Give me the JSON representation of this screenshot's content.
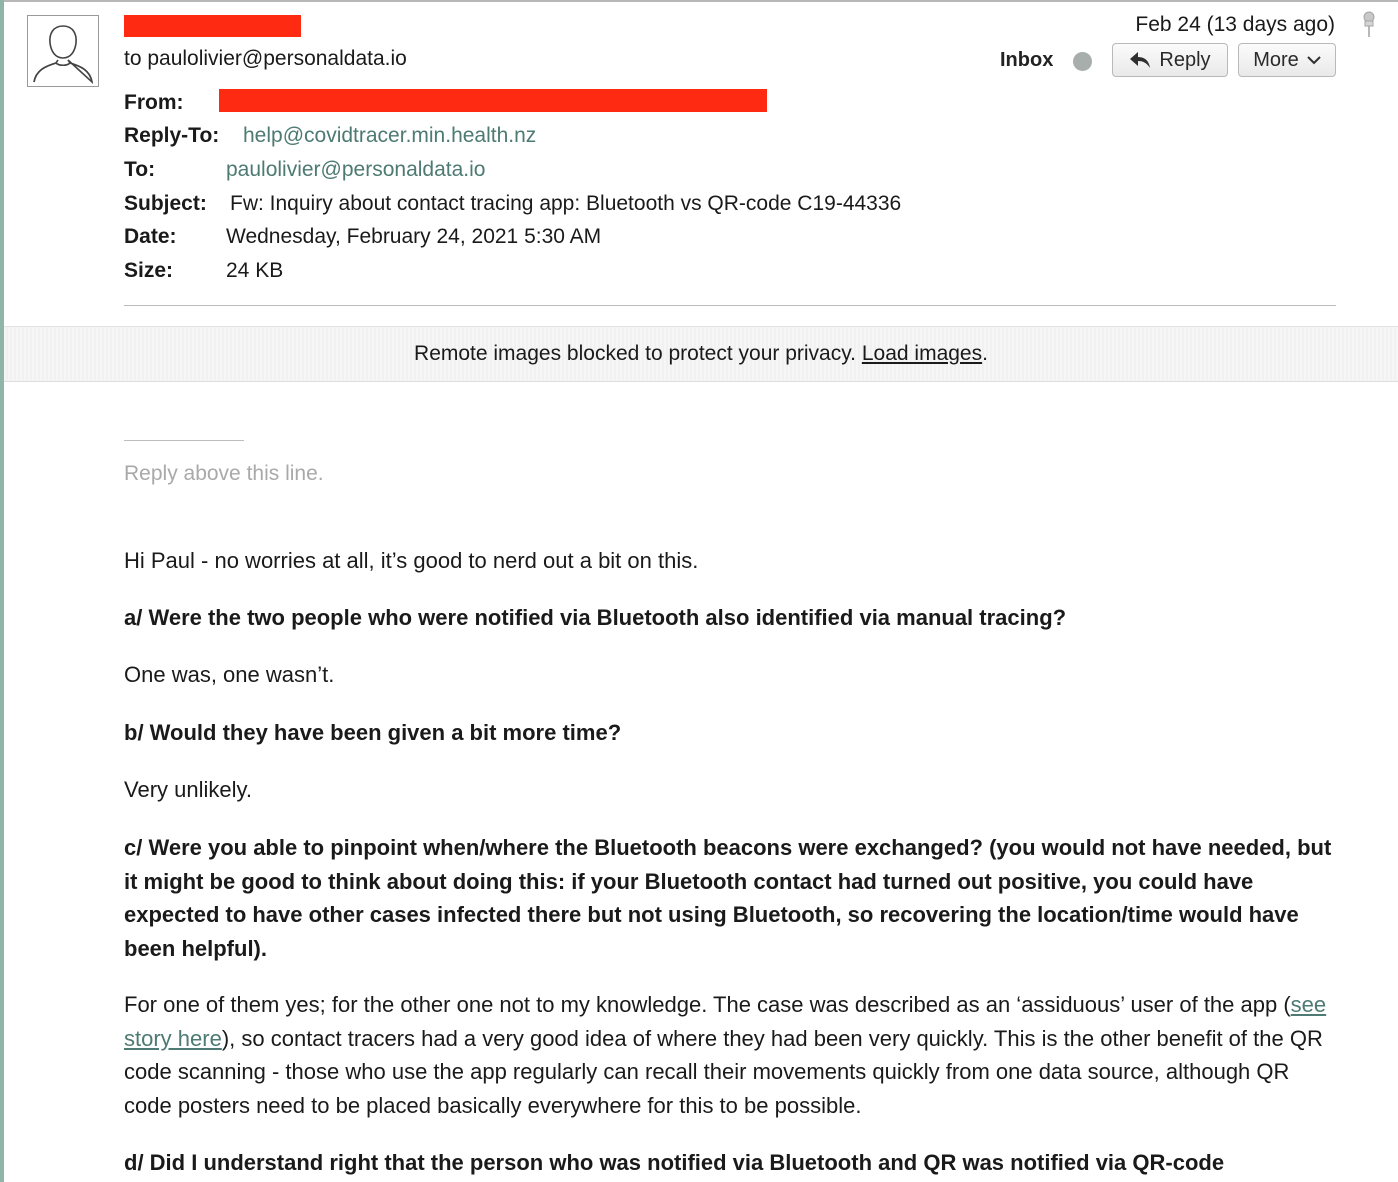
{
  "header": {
    "to_line": "to paulolivier@personaldata.io",
    "date_short": "Feb 24 (13 days ago)",
    "mailbox": "Inbox",
    "reply_label": "Reply",
    "more_label": "More"
  },
  "fields": {
    "from_label": "From:",
    "reply_to_label": "Reply-To:",
    "reply_to_value": "help@covidtracer.min.health.nz",
    "to_label": "To:",
    "to_value": "paulolivier@personaldata.io",
    "subject_label": "Subject:",
    "subject_value": "Fw: Inquiry about contact tracing app: Bluetooth vs QR-code C19-44336",
    "date_label": "Date:",
    "date_value": "Wednesday, February 24, 2021 5:30 AM",
    "size_label": "Size:",
    "size_value": "24 KB"
  },
  "privacy": {
    "message": "Remote images blocked to protect your privacy.",
    "link": "Load images",
    "period": "."
  },
  "body": {
    "reply_hint": "Reply above this line.",
    "greeting": "Hi Paul - no worries at all, it’s good to nerd out a bit on this.",
    "q_a": "a/ Were the two people who were notified via Bluetooth also identified via manual tracing?",
    "a_a": "One was, one wasn’t.",
    "q_b": "b/ Would they have been given a bit more time?",
    "a_b": "Very unlikely.",
    "q_c": "c/ Were you able to pinpoint when/where the Bluetooth beacons were exchanged? (you would not have needed, but it might be good to think about doing this: if your Bluetooth contact had turned out positive, you could have expected to have other cases infected there but not using Bluetooth, so recovering the location/time would have been helpful).",
    "a_c_part1": "For one of them yes; for the other one not to my knowledge. The case was described as an ‘assiduous’ user of the app (",
    "a_c_link": "see story here",
    "a_c_part2": "), so contact tracers had a very good idea of where they had been very quickly. This is the other benefit of the QR code scanning - those who use the app regularly can recall their movements quickly from one data source, although QR code posters need to be placed basically everywhere for this to be possible.",
    "q_d": "d/ Did I understand right that the person who was notified via Bluetooth and QR was notified via QR-code"
  },
  "colors": {
    "redaction": "#ff2a12",
    "link": "#4d7a72",
    "accent_border": "#8fb4a8"
  },
  "icons": {
    "avatar": "person-silhouette-icon",
    "pin": "pushpin-icon",
    "reply": "reply-arrow-icon",
    "more": "chevron-down-icon"
  }
}
